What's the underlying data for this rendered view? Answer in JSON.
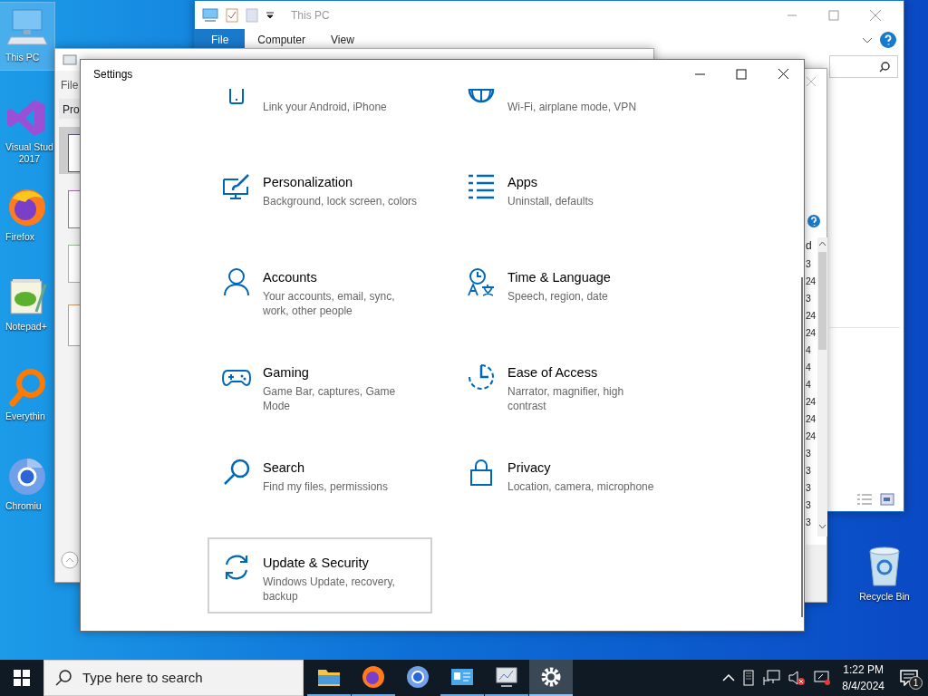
{
  "desktop_icons": [
    {
      "kind": "computer",
      "label": "This PC",
      "selected": true
    },
    {
      "kind": "vs",
      "label": "Visual Stud\n2017",
      "selected": false
    },
    {
      "kind": "firefox",
      "label": "Firefox",
      "selected": false
    },
    {
      "kind": "notepad",
      "label": "Notepad+",
      "selected": false
    },
    {
      "kind": "everything",
      "label": "Everythin",
      "selected": false
    },
    {
      "kind": "chromium",
      "label": "Chromiu",
      "selected": false
    }
  ],
  "recycle_bin": {
    "label": "Recycle Bin"
  },
  "explorer_window": {
    "title": "This PC",
    "ribbon_tabs": [
      {
        "label": "File",
        "selected": true
      },
      {
        "label": "Computer",
        "selected": false
      },
      {
        "label": "View",
        "selected": false
      }
    ]
  },
  "back_window": {
    "menu": "File",
    "column_header": "Pro"
  },
  "side_window": {
    "column_header": "d",
    "cells": [
      "3",
      "24",
      "3",
      "24",
      "24",
      "4",
      "4",
      "4",
      "24",
      "24",
      "24",
      "3",
      "3",
      "3",
      "3",
      "3"
    ]
  },
  "settings": {
    "title": "Settings",
    "tiles": [
      {
        "kind": "phone",
        "description": "Link your Android, iPhone",
        "selected": false
      },
      {
        "kind": "globe",
        "description": "Wi-Fi, airplane mode, VPN",
        "selected": false
      },
      {
        "kind": "paint",
        "title": "Personalization",
        "description": "Background, lock screen, colors",
        "selected": false
      },
      {
        "kind": "apps",
        "title": "Apps",
        "description": "Uninstall, defaults",
        "selected": false
      },
      {
        "kind": "account",
        "title": "Accounts",
        "description": "Your accounts, email, sync,\nwork, other people",
        "selected": false
      },
      {
        "kind": "language",
        "title": "Time & Language",
        "description": "Speech, region, date",
        "selected": false
      },
      {
        "kind": "gaming",
        "title": "Gaming",
        "description": "Game Bar, captures, Game\nMode",
        "selected": false
      },
      {
        "kind": "ease",
        "title": "Ease of Access",
        "description": "Narrator, magnifier, high\ncontrast",
        "selected": false
      },
      {
        "kind": "search",
        "title": "Search",
        "description": "Find my files, permissions",
        "selected": false
      },
      {
        "kind": "privacy",
        "title": "Privacy",
        "description": "Location, camera, microphone",
        "selected": false
      },
      {
        "kind": "update",
        "title": "Update & Security",
        "description": "Windows Update, recovery,\nbackup",
        "selected": true
      }
    ]
  },
  "taskbar": {
    "search_placeholder": "Type here to search",
    "apps": [
      {
        "kind": "explorer",
        "running": true,
        "selected": false
      },
      {
        "kind": "firefox",
        "running": true,
        "selected": false
      },
      {
        "kind": "chromium",
        "running": false,
        "selected": false
      },
      {
        "kind": "control",
        "running": true,
        "selected": false
      },
      {
        "kind": "monitor",
        "running": true,
        "selected": false
      },
      {
        "kind": "settings",
        "running": true,
        "selected": true
      }
    ],
    "time": "1:22 PM",
    "date": "8/4/2024",
    "notifications": "1"
  }
}
